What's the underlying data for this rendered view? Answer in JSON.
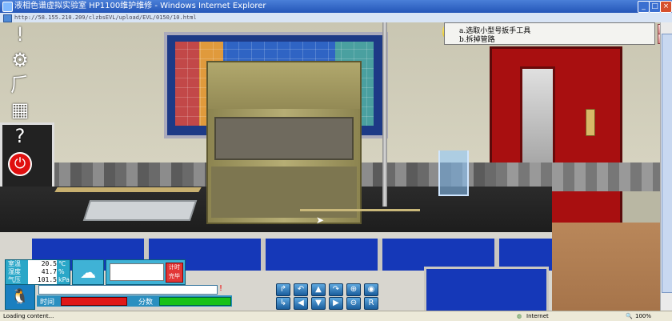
{
  "window": {
    "title": "液相色谱虚拟实验室 HP1100维护维修 - Windows Internet Explorer",
    "minimize": "_",
    "maximize": "□",
    "close": "×"
  },
  "address": {
    "url": "http://58.155.210.209/clzbsEVL/upload/EVL/0150/10.html"
  },
  "left_toolbar": {
    "items": [
      {
        "name": "exclamation-icon",
        "glyph": "!"
      },
      {
        "name": "gear-icon",
        "glyph": "⚙"
      },
      {
        "name": "wrench-icon",
        "glyph": "⺁"
      },
      {
        "name": "grid-icon",
        "glyph": "▦"
      },
      {
        "name": "help-icon",
        "glyph": "?"
      },
      {
        "name": "power-icon",
        "glyph": "⏻"
      }
    ]
  },
  "instruction_panel": {
    "steps": [
      "a.选取小型号扳手工具",
      "b.拆掉管路"
    ],
    "up": "▲",
    "down": "▼"
  },
  "environment": {
    "temp_label": "室温",
    "temp_value": "20.5",
    "temp_unit": "℃",
    "humidity_label": "湿度",
    "humidity_value": "41.7",
    "humidity_unit": "%",
    "pressure_label": "气压",
    "pressure_value": "101.5",
    "pressure_unit": "kPa"
  },
  "timer": {
    "button_label_1": "计时",
    "button_label_2": "完毕"
  },
  "status": {
    "time_label": "时间",
    "time_level": 0.9,
    "score_label": "分数",
    "score_level": 1.0,
    "warning_glyph": "!"
  },
  "controls": {
    "row1": [
      "↱",
      "↶",
      "▲",
      "↷",
      "⊕",
      "◉"
    ],
    "row2": [
      "↳",
      "◀",
      "▼",
      "▶",
      "⊖",
      "R"
    ]
  },
  "statusbar": {
    "loading": "Loading content...",
    "zone": "Internet",
    "zoom": "100%"
  },
  "colors": {
    "door": "#a80f10",
    "drawer_blue": "#1538b8",
    "hud_blue": "#2aa7c8",
    "time_bar": "#e01818",
    "score_bar": "#19c219"
  }
}
